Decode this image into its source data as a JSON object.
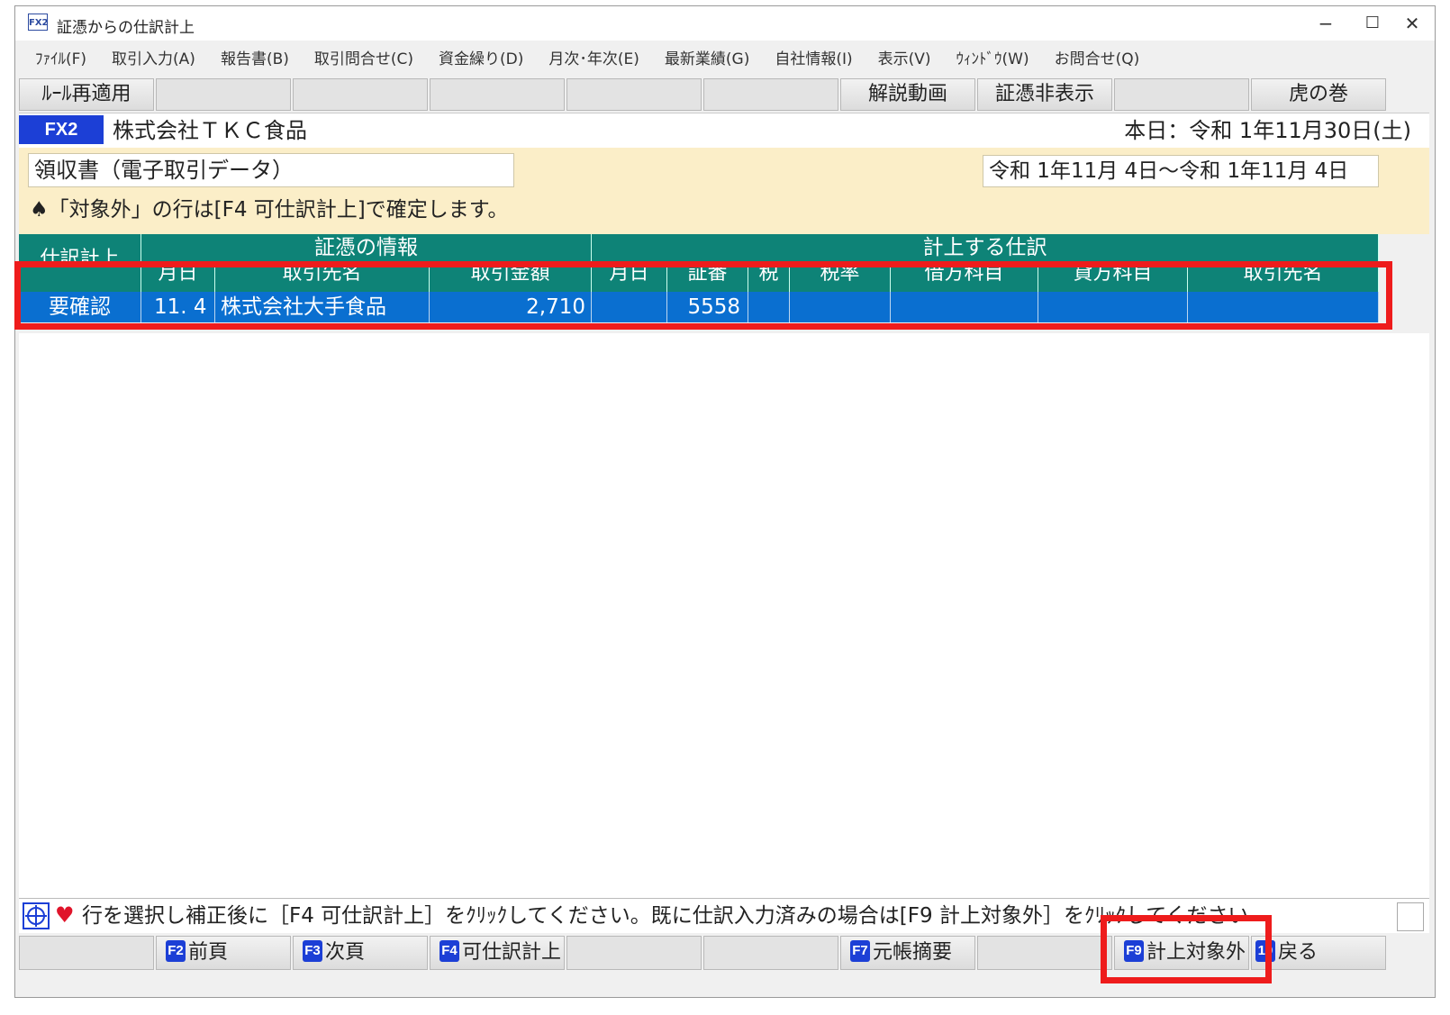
{
  "window": {
    "icon_text": "FX2",
    "title": "証憑からの仕訳計上",
    "controls": {
      "minimize": "−",
      "maximize": "☐",
      "close": "✕"
    }
  },
  "menu": [
    {
      "label": "ﾌｧｲﾙ(F)"
    },
    {
      "label": "取引入力(A)"
    },
    {
      "label": "報告書(B)"
    },
    {
      "label": "取引問合せ(C)"
    },
    {
      "label": "資金繰り(D)"
    },
    {
      "label": "月次･年次(E)"
    },
    {
      "label": "最新業績(G)"
    },
    {
      "label": "自社情報(I)"
    },
    {
      "label": "表示(V)"
    },
    {
      "label": "ｳｨﾝﾄﾞｳ(W)"
    },
    {
      "label": "お問合せ(Q)"
    }
  ],
  "toolbar": {
    "rule_reapply": "ﾙｰﾙ再適用",
    "video": "解説動画",
    "hide_voucher": "証憑非表示",
    "manual": "虎の巻"
  },
  "company": {
    "badge": "FX2",
    "name": "株式会社ＴＫＣ食品",
    "today": "本日：令和 1年11月30日(土)"
  },
  "filter": {
    "doc_type": "領収書（電子取引データ）",
    "date_range": "令和 1年11月 4日～令和 1年11月 4日",
    "instruction": "♠「対象外」の行は[F4 可仕訳計上]で確定します。"
  },
  "table": {
    "group_headers": {
      "row_label": "仕訳計上",
      "voucher_info": "証憑の情報",
      "journal": "計上する仕訳"
    },
    "columns": [
      "月日",
      "取引先名",
      "取引金額",
      "月日",
      "証番",
      "税",
      "税率",
      "借方科目",
      "貸方科目",
      "取引先名"
    ],
    "rows": [
      {
        "status": "要確認",
        "date": "11. 4",
        "partner": "株式会社大手食品",
        "amount": "2,710",
        "j_date": "",
        "voucher_no": "5558",
        "tax": "",
        "tax_rate": "",
        "debit": "",
        "credit": "",
        "j_partner": ""
      }
    ]
  },
  "message": {
    "text": "行を選択し補正後に［F4 可仕訳計上］をｸﾘｯｸしてください。既に仕訳入力済みの場合は[F9 計上対象外］をｸﾘｯｸしてください"
  },
  "fkeys": {
    "f2": {
      "key": "F2",
      "label": "前頁"
    },
    "f3": {
      "key": "F3",
      "label": "次頁"
    },
    "f4": {
      "key": "F4",
      "label": "可仕訳計上"
    },
    "f7": {
      "key": "F7",
      "label": "元帳摘要"
    },
    "f9": {
      "key": "F9",
      "label": "計上対象外"
    },
    "f10": {
      "key": "10",
      "label": "戻る"
    }
  },
  "colors": {
    "header_teal": "#0e8377",
    "selected_row": "#0a6fd0",
    "highlight_red": "#ee1c1c",
    "info_panel": "#fbeec8",
    "fx2_badge": "#1c3fd6"
  }
}
